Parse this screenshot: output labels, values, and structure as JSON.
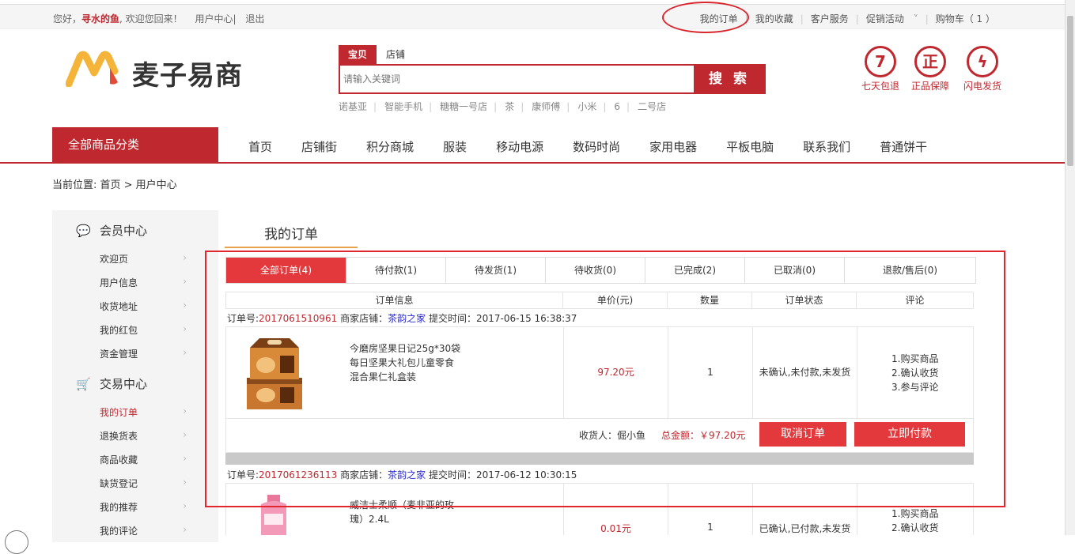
{
  "topbar": {
    "greeting_prefix": "您好，",
    "username": "寻水的鱼",
    "greeting_suffix": ", 欢迎您回来！",
    "user_center": "用户中心|",
    "logout": "退出",
    "my_orders": "我的订单",
    "favorites": "我的收藏",
    "service": "客户服务",
    "promo": "促销活动",
    "promo_arrow": "˅",
    "cart": "购物车（ 1 ）"
  },
  "logo": {
    "text": "麦子易商"
  },
  "search": {
    "tab_items": "宝贝",
    "tab_shops": "店铺",
    "placeholder": "请输入关键词",
    "button": "搜 索"
  },
  "hotwords": [
    "诺基亚",
    "智能手机",
    "糖糖一号店",
    "茶",
    "康师傅",
    "小米",
    "6",
    "二号店"
  ],
  "badges": [
    {
      "glyph": "7",
      "label": "七天包退"
    },
    {
      "glyph": "正",
      "label": "正品保障"
    },
    {
      "glyph": "ϟ",
      "label": "闪电发货"
    }
  ],
  "nav": {
    "all_categories": "全部商品分类",
    "items": [
      "首页",
      "店铺街",
      "积分商城",
      "服装",
      "移动电源",
      "数码时尚",
      "家用电器",
      "平板电脑",
      "联系我们",
      "普通饼干"
    ]
  },
  "breadcrumb": "当前位置: 首页 > 用户中心",
  "sidebar": {
    "member_center": "会员中心",
    "member_items": [
      "欢迎页",
      "用户信息",
      "收货地址",
      "我的红包",
      "资金管理"
    ],
    "trade_center": "交易中心",
    "trade_items": [
      "我的订单",
      "退换货表",
      "商品收藏",
      "缺货登记",
      "我的推荐",
      "我的评论"
    ],
    "chevron": "›"
  },
  "page_title": "我的订单",
  "order_tabs": [
    "全部订单(4)",
    "待付款(1)",
    "待发货(1)",
    "待收货(0)",
    "已完成(2)",
    "已取消(0)",
    "退款/售后(0)"
  ],
  "table_headers": [
    "订单信息",
    "单价(元)",
    "数量",
    "订单状态",
    "评论"
  ],
  "orders": [
    {
      "no_label": "订单号:",
      "no": "2017061510961",
      "shop_label": " 商家店铺：",
      "shop": "茶韵之家",
      "time": " 提交时间：2017-06-15 16:38:37",
      "name_lines": [
        "今磨房坚果日记25g*30袋",
        "每日坚果大礼包儿童零食",
        "混合果仁礼盒装"
      ],
      "price": "97.20元",
      "qty": "1",
      "status": "未确认,未付款,未发货",
      "comments": [
        "1.购买商品",
        "2.确认收货",
        "3.参与评论"
      ],
      "receiver": "收货人：倔小鱼",
      "total": "总金额：￥97.20元",
      "cancel": "取消订单",
      "pay": "立即付款"
    },
    {
      "no_label": "订单号:",
      "no": "2017061236113",
      "shop_label": " 商家店铺：",
      "shop": "茶韵之家",
      "time": " 提交时间：2017-06-12 10:30:15",
      "name_lines": [
        "威洁士柔顺（麦非亚的玫",
        "瑰）2.4L"
      ],
      "price": "0.01元",
      "qty": "1",
      "status": "已确认,已付款,未发货",
      "comments": [
        "1.购买商品",
        "2.确认收货"
      ]
    }
  ],
  "colors": {
    "brand": "#c0282f",
    "accent": "#e4393c",
    "annotation": "#e2262d"
  }
}
